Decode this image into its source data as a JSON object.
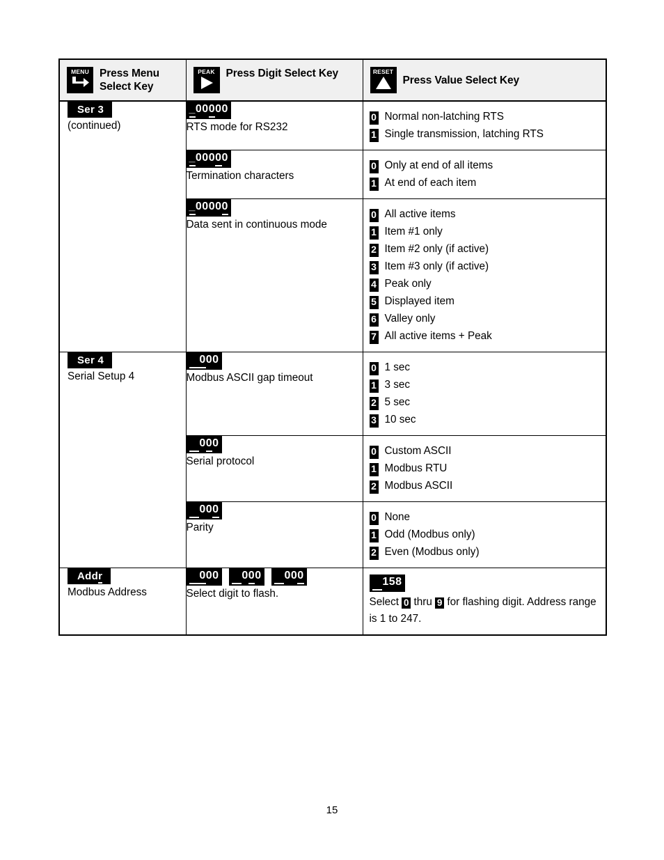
{
  "page": {
    "number": "15"
  },
  "table": {
    "headers": [
      {
        "icon": "menu-key-icon",
        "cap": "MENU",
        "label": "Press Menu Select Key"
      },
      {
        "icon": "peak-key-icon",
        "cap": "PEAK",
        "label": "Press Digit Select Key"
      },
      {
        "icon": "reset-key-icon",
        "cap": "RESET",
        "label": "Press Value Select Key"
      }
    ],
    "groups": [
      {
        "menu_badge": "Ser 3",
        "menu_badge_underline": "",
        "menu_desc": "(continued)",
        "rows": [
          {
            "lcds": [
              {
                "blanks": "_",
                "pre": "00",
                "ul": "0",
                "post": "00"
              }
            ],
            "lcd_text": "_00000",
            "desc": "RTS mode for RS232",
            "options": [
              {
                "key": "0",
                "text": "Normal non-latching RTS"
              },
              {
                "key": "1",
                "text": "Single transmission, latching RTS"
              }
            ]
          },
          {
            "lcds": [
              {
                "blanks": "_",
                "pre": "000",
                "ul": "0",
                "post": "0"
              }
            ],
            "lcd_text": "_00000",
            "desc": "Termination characters",
            "options": [
              {
                "key": "0",
                "text": "Only at end of all items"
              },
              {
                "key": "1",
                "text": "At end of each item"
              }
            ]
          },
          {
            "lcds": [
              {
                "blanks": "_",
                "pre": "0000",
                "ul": "0",
                "post": ""
              }
            ],
            "lcd_text": "_00000",
            "desc": "Data sent in continuous mode",
            "options": [
              {
                "key": "0",
                "text": "All active items"
              },
              {
                "key": "1",
                "text": "Item #1 only"
              },
              {
                "key": "2",
                "text": "Item #2 only (if active)"
              },
              {
                "key": "3",
                "text": "Item #3 only (if active)"
              },
              {
                "key": "4",
                "text": "Peak only"
              },
              {
                "key": "5",
                "text": "Displayed item"
              },
              {
                "key": "6",
                "text": "Valley only"
              },
              {
                "key": "7",
                "text": "All active items + Peak"
              }
            ]
          }
        ]
      },
      {
        "menu_badge": "Ser 4",
        "menu_badge_underline": "",
        "menu_desc": "Serial Setup 4",
        "rows": [
          {
            "lcds": [
              {
                "blanks": "   ",
                "pre": "",
                "ul": "0",
                "post": "00"
              }
            ],
            "lcd_text": "   000",
            "desc": "Modbus ASCII gap timeout",
            "options": [
              {
                "key": "0",
                "text": "1 sec"
              },
              {
                "key": "1",
                "text": "3 sec"
              },
              {
                "key": "2",
                "text": "5 sec"
              },
              {
                "key": "3",
                "text": "10 sec"
              }
            ]
          },
          {
            "lcds": [
              {
                "blanks": "   ",
                "pre": "0",
                "ul": "0",
                "post": "0"
              }
            ],
            "lcd_text": "   000",
            "desc": "Serial protocol",
            "options": [
              {
                "key": "0",
                "text": "Custom ASCII"
              },
              {
                "key": "1",
                "text": "Modbus RTU"
              },
              {
                "key": "2",
                "text": "Modbus ASCII"
              }
            ]
          },
          {
            "lcds": [
              {
                "blanks": "   ",
                "pre": "00",
                "ul": "0",
                "post": ""
              }
            ],
            "lcd_text": "   000",
            "desc": "Parity",
            "options": [
              {
                "key": "0",
                "text": "None"
              },
              {
                "key": "1",
                "text": "Odd (Modbus only)"
              },
              {
                "key": "2",
                "text": "Even (Modbus only)"
              }
            ]
          }
        ]
      },
      {
        "menu_badge": "Addr",
        "menu_badge_underline": "r",
        "menu_desc": "Modbus Address",
        "rows": [
          {
            "lcds": [
              {
                "blanks": "   ",
                "pre": "",
                "ul": "0",
                "post": "00"
              },
              {
                "blanks": "   ",
                "pre": "0",
                "ul": "0",
                "post": "0"
              },
              {
                "blanks": "   ",
                "pre": "00",
                "ul": "0",
                "post": ""
              }
            ],
            "lcd_text": "   000   000   000",
            "desc": "Select digit to flash.",
            "value_lcd": {
              "blanks": "   ",
              "digits": "158"
            },
            "value_lcd_text": "   158",
            "instruction_pre": "Select ",
            "instruction_chip1": "0",
            "instruction_mid": " thru ",
            "instruction_chip2": "9",
            "instruction_post": " for flashing digit. Address range is 1 to 247."
          }
        ]
      }
    ]
  }
}
